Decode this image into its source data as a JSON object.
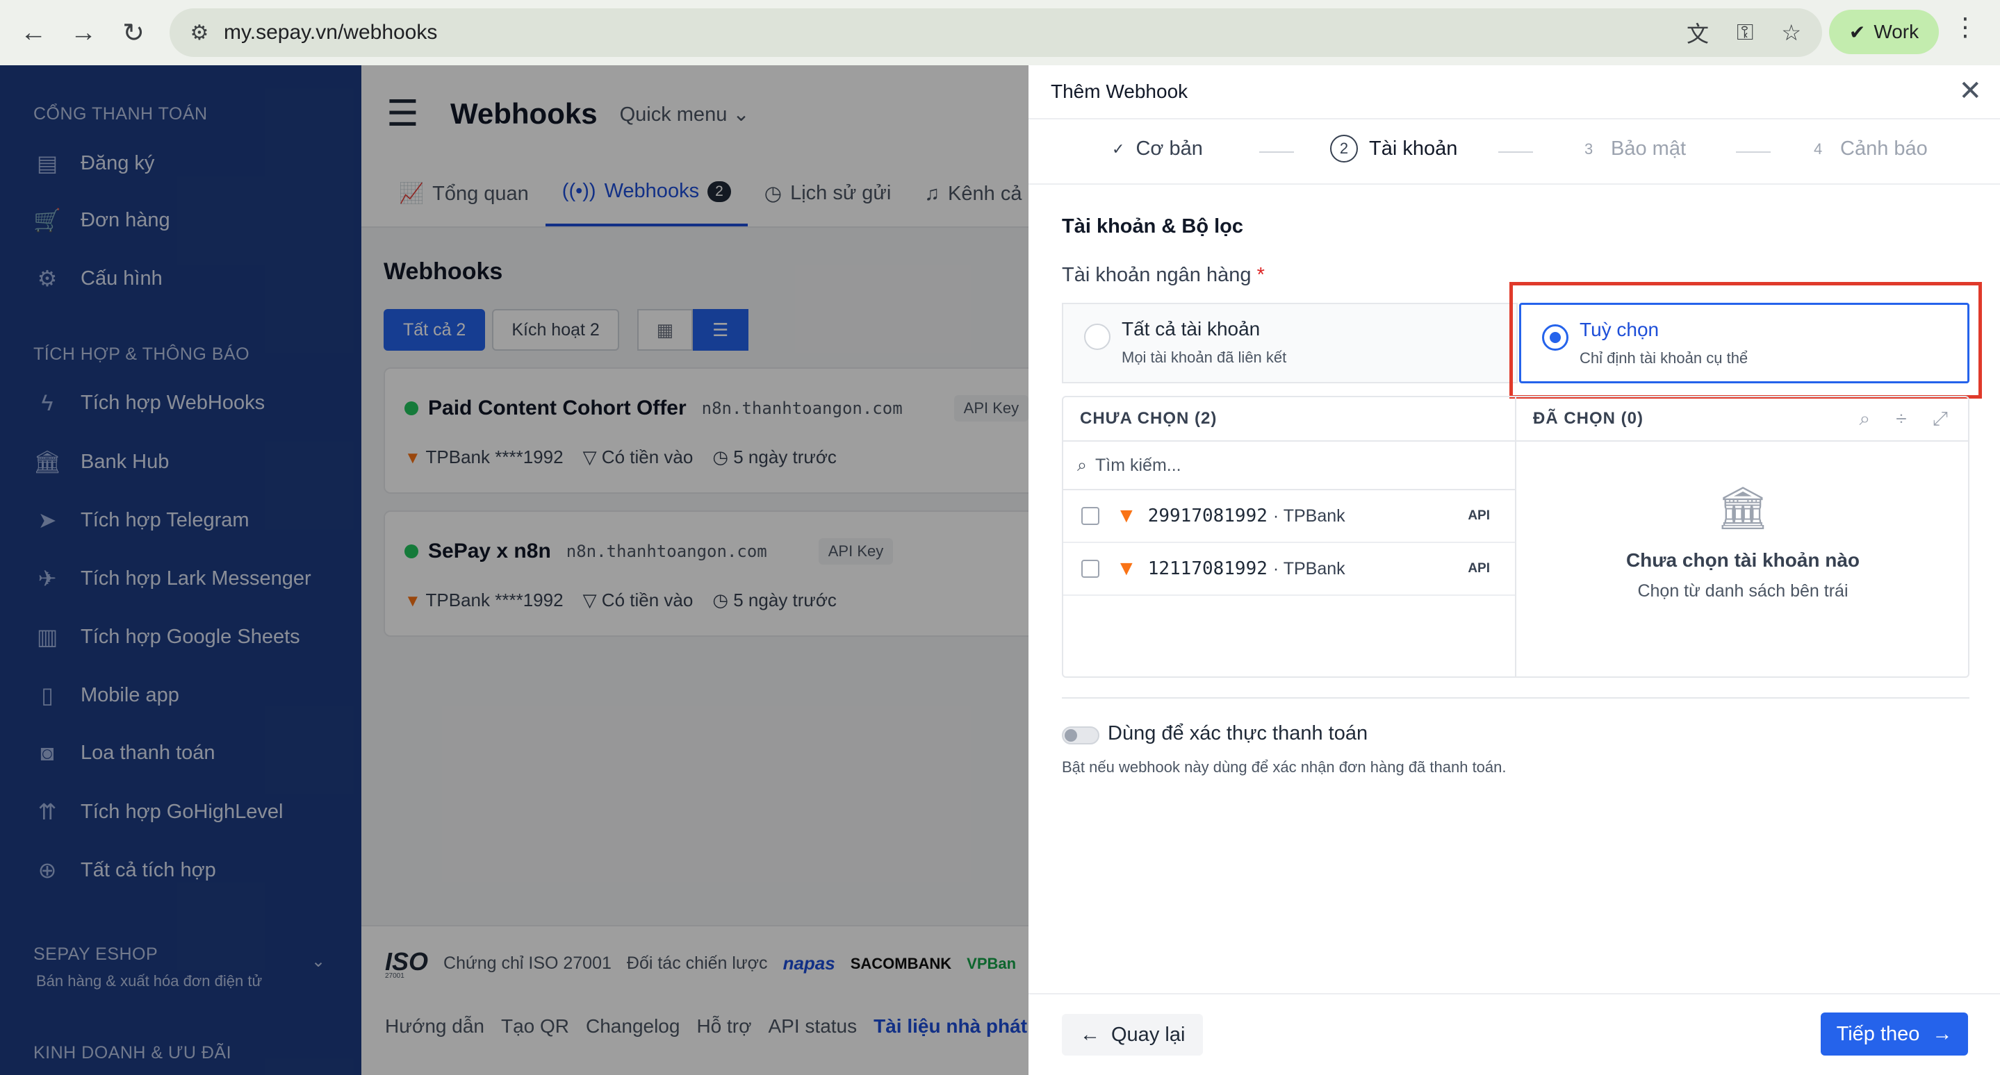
{
  "browser": {
    "url": "my.sepay.vn/webhooks",
    "profile": "Work",
    "icons": [
      "back-icon",
      "forward-icon",
      "reload-icon",
      "translate-icon",
      "key-icon",
      "star-icon",
      "kebab-icon"
    ]
  },
  "sidebar": {
    "sections": [
      {
        "title": "CỔNG THANH TOÁN",
        "items": [
          "Đăng ký",
          "Đơn hàng",
          "Cấu hình"
        ]
      },
      {
        "title": "TÍCH HỢP & THÔNG BÁO",
        "items": [
          "Tích hợp WebHooks",
          "Bank Hub",
          "Tích hợp Telegram",
          "Tích hợp Lark Messenger",
          "Tích hợp Google Sheets",
          "Mobile app",
          "Loa thanh toán",
          "Tích hợp GoHighLevel",
          "Tất cả tích hợp"
        ]
      }
    ],
    "eshop_title": "SEPAY ESHOP",
    "eshop_subtitle": "Bán hàng & xuất hóa đơn điện tử",
    "last_section": "KINH DOANH & ƯU ĐÃI"
  },
  "main": {
    "title": "Webhooks",
    "quick_menu": "Quick menu",
    "tabs": [
      {
        "label": "Tổng quan"
      },
      {
        "label": "Webhooks",
        "badge": "2"
      },
      {
        "label": "Lịch sử gửi"
      },
      {
        "label": "Kênh cả"
      }
    ],
    "section_title": "Webhooks",
    "filters": {
      "all": "Tất cả 2",
      "active": "Kích hoạt 2"
    },
    "webhooks": [
      {
        "name": "Paid Content Cohort Offer",
        "host": "n8n.thanhtoangon.com",
        "auth": "API Key",
        "bank": "TPBank ****1992",
        "filter": "Có tiền vào",
        "time": "5 ngày trước"
      },
      {
        "name": "SePay x n8n",
        "host": "n8n.thanhtoangon.com",
        "auth": "API Key",
        "bank": "TPBank ****1992",
        "filter": "Có tiền vào",
        "time": "5 ngày trước"
      }
    ],
    "footer": {
      "iso": "ISO",
      "iso_num": "27001",
      "iso_text": "Chứng chỉ ISO 27001",
      "partners_label": "Đối tác chiến lược",
      "partners": [
        "napas",
        "SACOMBANK",
        "VPBan"
      ],
      "links": [
        "Hướng dẫn",
        "Tạo QR",
        "Changelog",
        "Hỗ trợ",
        "API status",
        "Tài liệu nhà phát"
      ]
    }
  },
  "drawer": {
    "title": "Thêm Webhook",
    "steps": [
      {
        "num": "",
        "label": "Cơ bản"
      },
      {
        "num": "2",
        "label": "Tài khoản"
      },
      {
        "num": "3",
        "label": "Bảo mật"
      },
      {
        "num": "4",
        "label": "Cảnh báo"
      }
    ],
    "section": "Tài khoản & Bộ lọc",
    "field_label": "Tài khoản ngân hàng",
    "required_mark": "*",
    "options": [
      {
        "title": "Tất cả tài khoản",
        "subtitle": "Mọi tài khoản đã liên kết",
        "selected": false
      },
      {
        "title": "Tuỳ chọn",
        "subtitle": "Chỉ định tài khoản cụ thể",
        "selected": true
      }
    ],
    "unselected_header": "CHƯA CHỌN (2)",
    "selected_header": "ĐÃ CHỌN (0)",
    "search_placeholder": "Tìm kiếm...",
    "accounts": [
      {
        "number": "29917081992",
        "bank": "· TPBank",
        "tag": "API"
      },
      {
        "number": "12117081992",
        "bank": "· TPBank",
        "tag": "API"
      }
    ],
    "empty_title": "Chưa chọn tài khoản nào",
    "empty_subtitle": "Chọn từ danh sách bên trái",
    "payment_toggle_label": "Dùng để xác thực thanh toán",
    "payment_toggle_hint": "Bật nếu webhook này dùng để xác nhận đơn hàng đã thanh toán.",
    "payment_toggle_on": false,
    "back_label": "Quay lại",
    "next_label": "Tiếp theo"
  },
  "colors": {
    "primary": "#2563eb",
    "sidebar": "#1e3d83",
    "highlight": "#e03a2b",
    "tpbank": "#f97316"
  }
}
